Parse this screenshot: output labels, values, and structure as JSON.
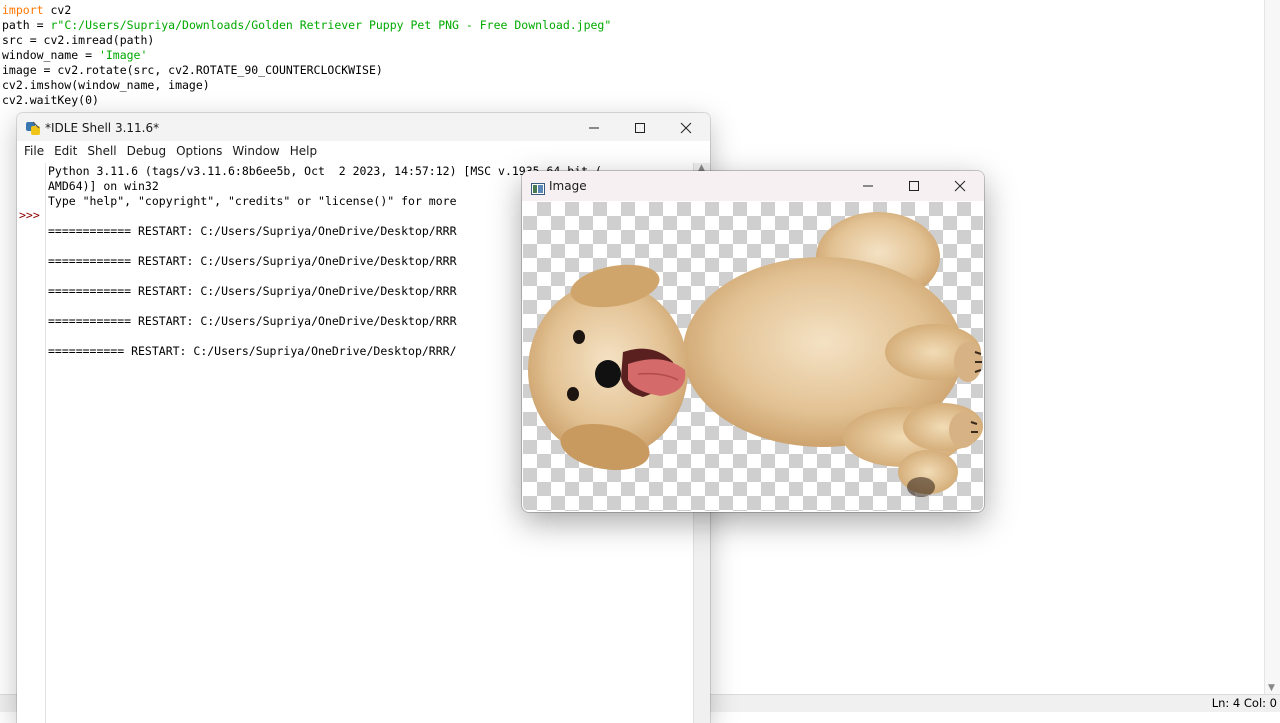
{
  "editor": {
    "code_lines": [
      [
        {
          "t": "import",
          "c": "kw"
        },
        {
          "t": " cv2",
          "c": ""
        }
      ],
      [
        {
          "t": "path = ",
          "c": ""
        },
        {
          "t": "r\"C:/Users/Supriya/Downloads/Golden Retriever Puppy Pet PNG - Free Download.jpeg\"",
          "c": "str"
        }
      ],
      [
        {
          "t": "src = cv2.imread(path)",
          "c": ""
        }
      ],
      [
        {
          "t": "window_name = ",
          "c": ""
        },
        {
          "t": "'Image'",
          "c": "str"
        }
      ],
      [
        {
          "t": "image = cv2.rotate(src, cv2.ROTATE_90_COUNTERCLOCKWISE)",
          "c": ""
        }
      ],
      [
        {
          "t": "cv2.imshow(window_name, image)",
          "c": ""
        }
      ],
      [
        {
          "t": "cv2.waitKey(0)",
          "c": ""
        }
      ]
    ],
    "status": "Ln: 4  Col: 0"
  },
  "shell": {
    "title": "*IDLE Shell 3.11.6*",
    "menu": [
      "File",
      "Edit",
      "Shell",
      "Debug",
      "Options",
      "Window",
      "Help"
    ],
    "prompt": ">>>",
    "lines": [
      "Python 3.11.6 (tags/v3.11.6:8b6ee5b, Oct  2 2023, 14:57:12) [MSC v.1935 64 bit (",
      "AMD64)] on win32",
      "Type \"help\", \"copyright\", \"credits\" or \"license()\" for more",
      "",
      "============ RESTART: C:/Users/Supriya/OneDrive/Desktop/RRR",
      "",
      "============ RESTART: C:/Users/Supriya/OneDrive/Desktop/RRR",
      "",
      "============ RESTART: C:/Users/Supriya/OneDrive/Desktop/RRR",
      "",
      "============ RESTART: C:/Users/Supriya/OneDrive/Desktop/RRR",
      "",
      "=========== RESTART: C:/Users/Supriya/OneDrive/Desktop/RRR/"
    ]
  },
  "image_window": {
    "title": "Image",
    "content": "golden-retriever-puppy-rotated"
  },
  "window_controls": {
    "minimize": "—",
    "maximize": "□",
    "close": "✕"
  },
  "colors": {
    "keyword": "#ff7700",
    "string": "#00aa00",
    "prompt": "#8b0000"
  }
}
